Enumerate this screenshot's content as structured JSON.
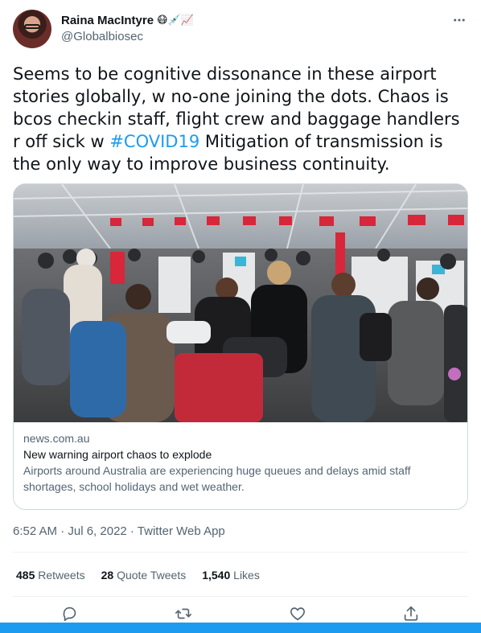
{
  "author": {
    "display_name": "Raina MacIntyre",
    "emojis": "😷💉📈",
    "handle": "@Globalbiosec"
  },
  "tweet": {
    "text_before": "Seems to be cognitive dissonance in these airport stories globally, w no-one joining the dots. Chaos is bcos checkin staff, flight crew and baggage handlers r off sick w ",
    "hashtag": "#COVID19",
    "text_after": " Mitigation of transmission is the only way to improve business continuity."
  },
  "card": {
    "domain": "news.com.au",
    "title": "New warning airport chaos to explode",
    "description": "Airports around Australia are experiencing huge queues and delays amid staff shortages, school holidays and wet weather."
  },
  "meta": {
    "timestamp": "6:52 AM · Jul 6, 2022 · Twitter Web App"
  },
  "stats": {
    "retweets_count": "485",
    "retweets_label": "Retweets",
    "quotes_count": "28",
    "quotes_label": "Quote Tweets",
    "likes_count": "1,540",
    "likes_label": "Likes"
  },
  "icons": [
    "more-icon",
    "reply-icon",
    "retweet-icon",
    "like-icon",
    "share-icon"
  ],
  "colors": {
    "accent": "#1d9bf0",
    "text": "#0f1419",
    "secondary": "#536471",
    "border": "#cfd9de"
  }
}
